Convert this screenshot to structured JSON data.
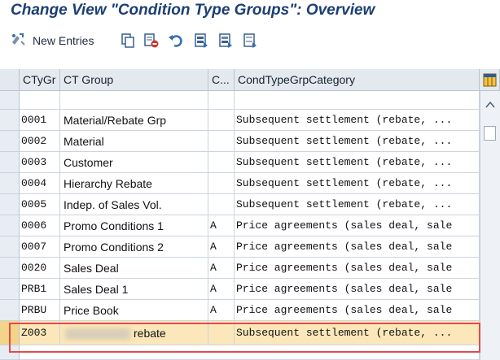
{
  "window": {
    "title": "Change View \"Condition Type Groups\": Overview"
  },
  "toolbar": {
    "new_entries_label": "New Entries",
    "icons": [
      "display-change-icon",
      "copy-icon",
      "delete-icon",
      "undo-icon",
      "select-all-icon",
      "select-block-icon",
      "deselect-all-icon"
    ]
  },
  "table": {
    "columns": {
      "code": "CTyGr",
      "group": "CT Group",
      "c": "C...",
      "category": "CondTypeGrpCategory"
    },
    "rows": [
      {
        "code": "",
        "group": "",
        "c": "",
        "category": ""
      },
      {
        "code": "0001",
        "group": "Material/Rebate Grp",
        "c": "",
        "category": "Subsequent settlement (rebate, ..."
      },
      {
        "code": "0002",
        "group": "Material",
        "c": "",
        "category": "Subsequent settlement (rebate, ..."
      },
      {
        "code": "0003",
        "group": "Customer",
        "c": "",
        "category": "Subsequent settlement (rebate, ..."
      },
      {
        "code": "0004",
        "group": "Hierarchy Rebate",
        "c": "",
        "category": "Subsequent settlement (rebate, ..."
      },
      {
        "code": "0005",
        "group": "Indep. of Sales Vol.",
        "c": "",
        "category": "Subsequent settlement (rebate, ..."
      },
      {
        "code": "0006",
        "group": "Promo Conditions 1",
        "c": "A",
        "category": "Price agreements (sales deal, sale"
      },
      {
        "code": "0007",
        "group": "Promo Conditions 2",
        "c": "A",
        "category": "Price agreements (sales deal, sale"
      },
      {
        "code": "0020",
        "group": "Sales Deal",
        "c": "A",
        "category": "Price agreements (sales deal, sale"
      },
      {
        "code": "PRB1",
        "group": "Sales Deal 1",
        "c": "A",
        "category": "Price agreements (sales deal, sale"
      },
      {
        "code": "PRBU",
        "group": "Price Book",
        "c": "A",
        "category": "Price agreements (sales deal, sale"
      },
      {
        "code": "Z003",
        "group": "rebate",
        "c": "",
        "category": "Subsequent settlement (rebate, ..."
      }
    ],
    "highlight_color": "#fbe7b9",
    "annotation_color": "#e24b4b"
  }
}
